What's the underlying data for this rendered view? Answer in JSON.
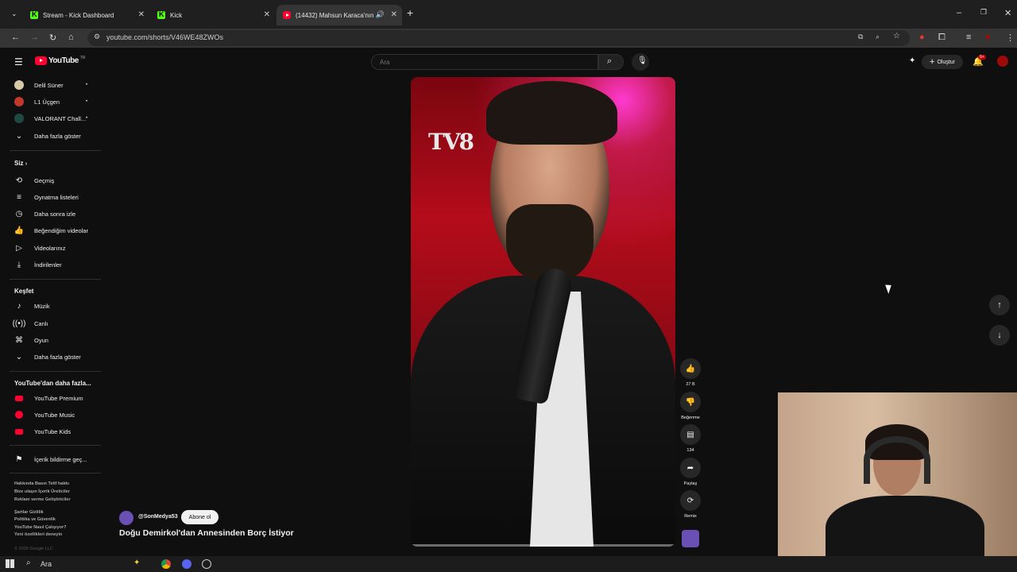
{
  "browser": {
    "tabs": [
      {
        "title": "Stream - Kick Dashboard",
        "icon": "kick-icon",
        "active": false
      },
      {
        "title": "Kick",
        "icon": "kick-icon",
        "active": false
      },
      {
        "title": "(14432) Mahsun Karaca'nın",
        "icon": "youtube-icon",
        "active": true
      }
    ],
    "new_tab": "+",
    "url": "youtube.com/shorts/V46WE48ZWOs",
    "window_controls": {
      "minimize": "–",
      "maximize": "❐",
      "close": "✕"
    }
  },
  "youtube": {
    "logo_text": "YouTube",
    "logo_region": "TR",
    "search_placeholder": "Ara",
    "create_label": "Oluştur",
    "notif_count": "9+"
  },
  "sidebar": {
    "subscriptions": [
      {
        "label": "Delil Süner",
        "color": "#d9c9a8"
      },
      {
        "label": "L1 Üçgen",
        "color": "#c0392b"
      },
      {
        "label": "VALORANT Chall...",
        "color": "#1f4a44"
      }
    ],
    "show_more_1": "Daha fazla göster",
    "you_heading": "Siz",
    "you_items": [
      {
        "label": "Geçmiş",
        "icon": "history-icon"
      },
      {
        "label": "Oynatma listeleri",
        "icon": "playlists-icon"
      },
      {
        "label": "Daha sonra izle",
        "icon": "watch-later-icon"
      },
      {
        "label": "Beğendiğim videolar",
        "icon": "like-icon"
      },
      {
        "label": "Videolarınız",
        "icon": "your-videos-icon"
      },
      {
        "label": "İndirilenler",
        "icon": "download-icon"
      }
    ],
    "explore_heading": "Keşfet",
    "explore_items": [
      {
        "label": "Müzik",
        "icon": "music-icon"
      },
      {
        "label": "Canlı",
        "icon": "live-icon"
      },
      {
        "label": "Oyun",
        "icon": "gaming-icon"
      }
    ],
    "show_more_2": "Daha fazla göster",
    "more_heading": "YouTube'dan daha fazla...",
    "more_items": [
      {
        "label": "YouTube Premium"
      },
      {
        "label": "YouTube Music"
      },
      {
        "label": "YouTube Kids"
      }
    ],
    "report_label": "İçerik bildirme geç...",
    "footer_lines": [
      "Hakkında  Basın  Telif hakkı",
      "Bize ulaşın  İçerik Üreticiler",
      "Reklam verme  Geliştiriciler",
      "Şartlar  Gizlilik",
      "Politika ve Güvenlik",
      "YouTube Nasıl Çalışıyor?",
      "Yeni özellikleri deneyin"
    ],
    "copyright": "© 2026 Google LLC"
  },
  "short": {
    "channel": "@SonMedya53",
    "subscribe_label": "Abone ol",
    "title": "Doğu Demirkol'dan Annesinden Borç İstiyor",
    "watermark": "TV8",
    "progress": 0.0
  },
  "actions": {
    "like_count": "27 B",
    "dislike_label": "Beğenme",
    "comment_count": "134",
    "share_label": "Paylaş",
    "remix_label": "Remix"
  },
  "taskbar": {
    "search_label": "Ara"
  }
}
